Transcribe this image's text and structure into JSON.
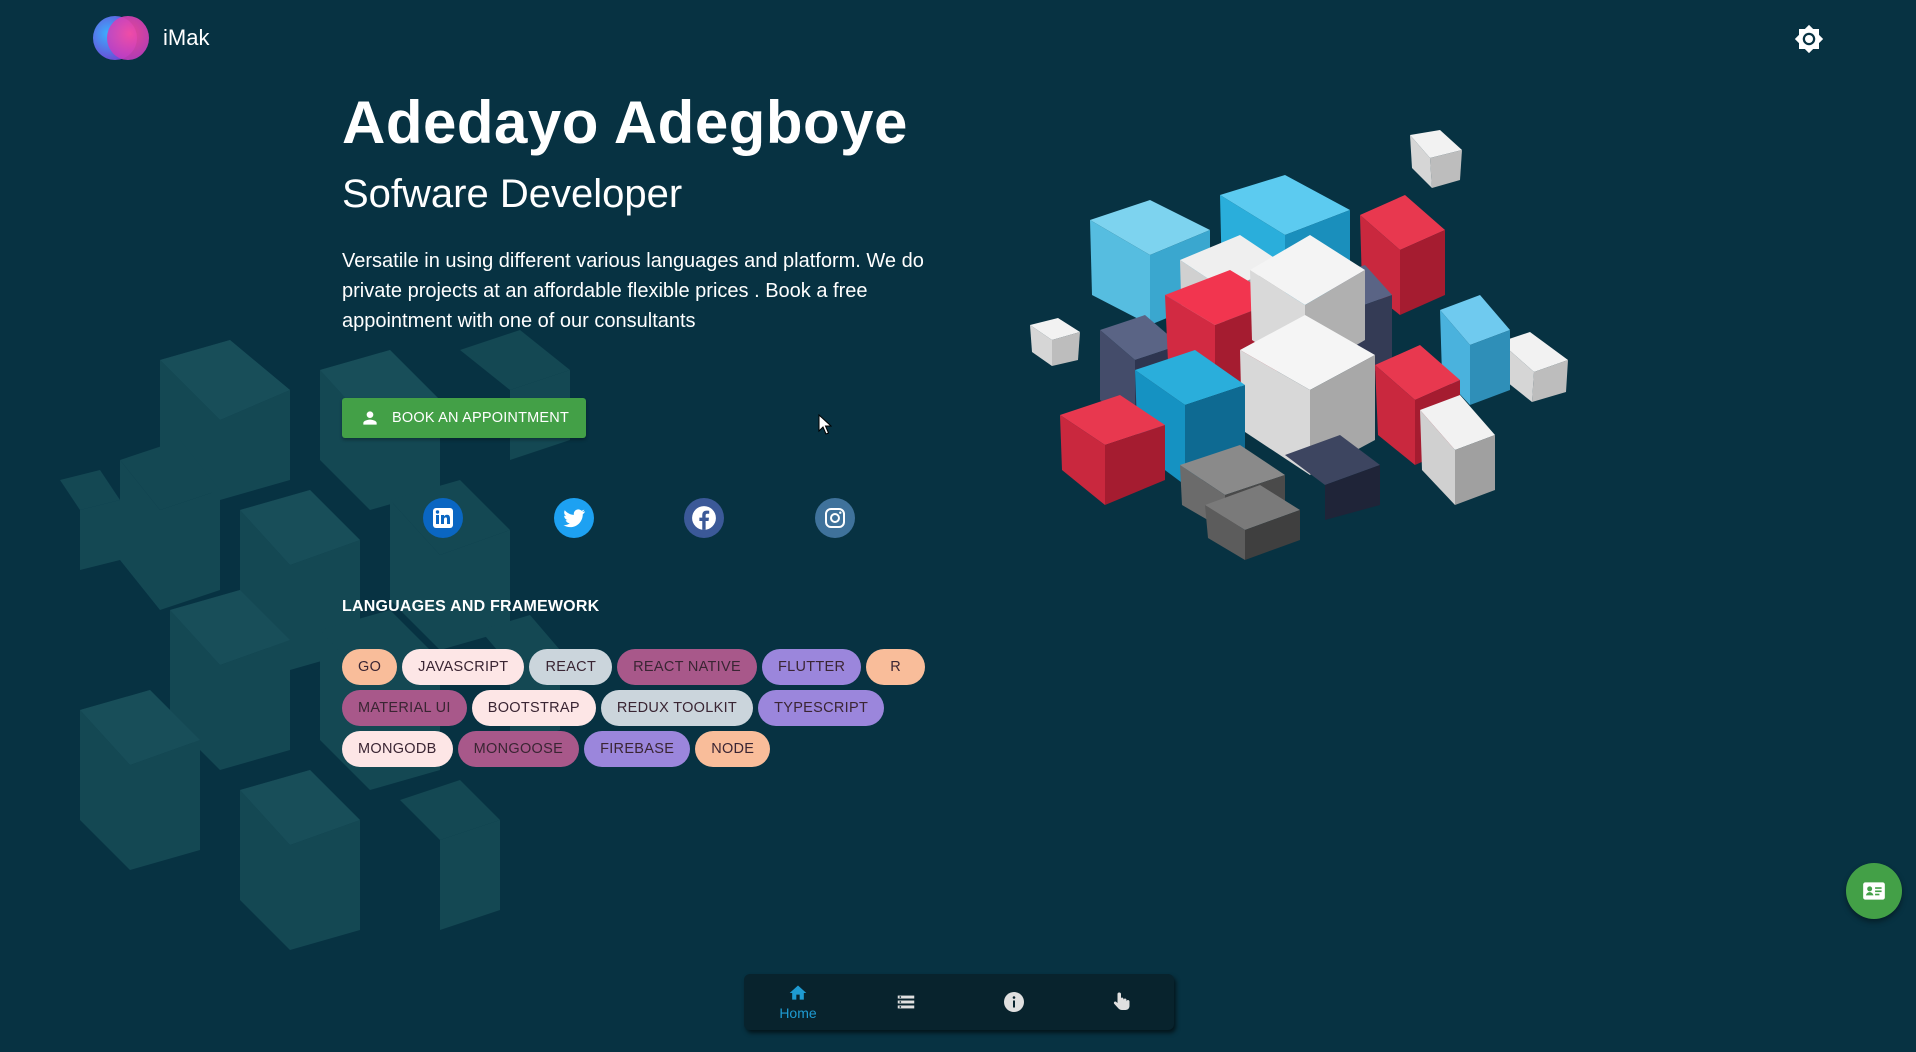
{
  "brand": {
    "name": "iMak"
  },
  "hero": {
    "name": "Adedayo Adegboye",
    "role": "Sofware Developer",
    "description": "Versatile in using different various languages and platform. We do private projects at an affordable flexible prices . Book a free appointment with one of our consultants",
    "cta_label": "BOOK AN APPOINTMENT"
  },
  "socials": [
    {
      "name": "linkedin-icon",
      "color": "#0a66c2"
    },
    {
      "name": "twitter-icon",
      "color": "#1da1f2"
    },
    {
      "name": "facebook-icon",
      "color": "#3b5998"
    },
    {
      "name": "instagram-icon",
      "color": "#3f729b"
    }
  ],
  "skills": {
    "title": "LANGUAGES AND FRAMEWORK",
    "rows": [
      [
        "GO",
        "JAVASCRIPT",
        "REACT",
        "REACT NATIVE",
        "FLUTTER",
        "R"
      ],
      [
        "MATERIAL UI",
        "BOOTSTRAP",
        "REDUX TOOLKIT",
        "TYPESCRIPT"
      ],
      [
        "MONGODB",
        "MONGOOSE",
        "FIREBASE",
        "NODE"
      ]
    ]
  },
  "bottom_nav": {
    "items": [
      {
        "icon": "home-icon",
        "label": "Home",
        "active": true
      },
      {
        "icon": "list-icon",
        "label": ""
      },
      {
        "icon": "info-icon",
        "label": ""
      },
      {
        "icon": "touch-icon",
        "label": ""
      }
    ]
  },
  "colors": {
    "background": "#073242",
    "accent": "#43a047",
    "active_nav": "#1e9bd2"
  }
}
